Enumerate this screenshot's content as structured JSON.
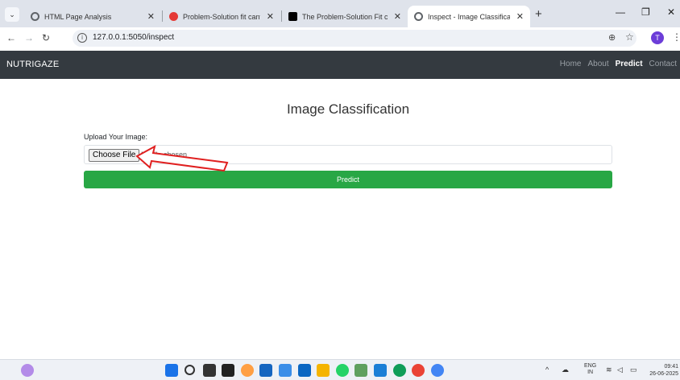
{
  "browser": {
    "tabs": [
      {
        "title": "HTML Page Analysis",
        "icon": "globe-icon",
        "color": "#5f6368"
      },
      {
        "title": "Problem-Solution fit canvas — ",
        "icon": "canva-icon",
        "color": "#e53935"
      },
      {
        "title": "The Problem-Solution Fit canva",
        "icon": "medium-icon",
        "color": "#000000"
      },
      {
        "title": "Inspect - Image Classification",
        "icon": "globe-icon",
        "color": "#5f6368",
        "active": true
      }
    ],
    "url": "127.0.0.1:5050/inspect"
  },
  "site": {
    "brand": "NUTRIGAZE",
    "nav": [
      "Home",
      "About",
      "Predict",
      "Contact"
    ],
    "active_nav": "Predict"
  },
  "main": {
    "title": "Image Classification",
    "upload_label": "Upload Your Image:",
    "choose_file_label": "Choose File",
    "file_status": "No file chosen",
    "predict_label": "Predict"
  },
  "taskbar": {
    "lang_line1": "ENG",
    "lang_line2": "IN",
    "time": "09:41",
    "date": "26-06-2025"
  },
  "colors": {
    "navbar": "#343a40",
    "predict": "#28a745",
    "annotation_arrow": "#e02020"
  }
}
